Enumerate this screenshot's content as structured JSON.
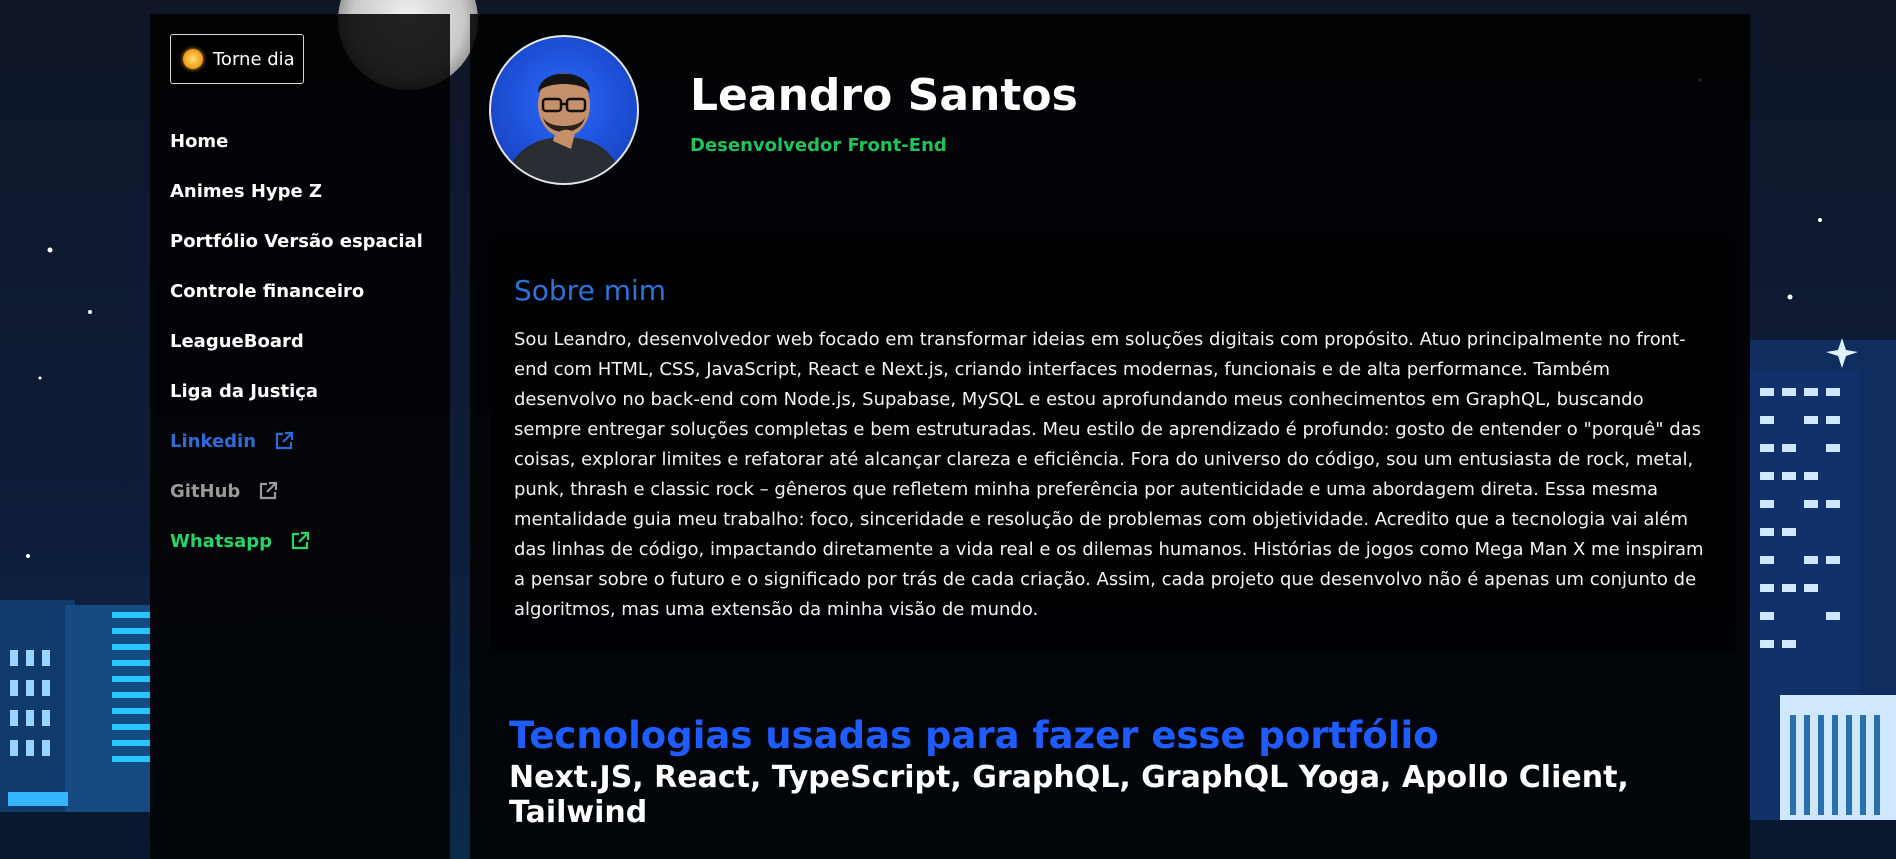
{
  "theme_toggle": {
    "icon": "sun-icon",
    "label": "Torne dia"
  },
  "sidebar": {
    "items": [
      {
        "label": "Home",
        "external": false
      },
      {
        "label": "Animes Hype Z",
        "external": false
      },
      {
        "label": "Portfólio Versão espacial",
        "external": false
      },
      {
        "label": "Controle financeiro",
        "external": false
      },
      {
        "label": "LeagueBoard",
        "external": false
      },
      {
        "label": "Liga da Justiça",
        "external": false
      },
      {
        "label": "Linkedin",
        "external": true,
        "color": "#2e6bd9"
      },
      {
        "label": "GitHub",
        "external": true,
        "color": "#9a9a9a"
      },
      {
        "label": "Whatsapp",
        "external": true,
        "color": "#25d366"
      }
    ]
  },
  "profile": {
    "name": "Leandro Santos",
    "role": "Desenvolvedor Front-End"
  },
  "about": {
    "heading": "Sobre mim",
    "text": "Sou Leandro, desenvolvedor web focado em transformar ideias em soluções digitais com propósito. Atuo principalmente no front-end com HTML, CSS, JavaScript, React e Next.js, criando interfaces modernas, funcionais e de alta performance. Também desenvolvo no back-end com Node.js, Supabase, MySQL e estou aprofundando meus conhecimentos em GraphQL, buscando sempre entregar soluções completas e bem estruturadas. Meu estilo de aprendizado é profundo: gosto de entender o \"porquê\" das coisas, explorar limites e refatorar até alcançar clareza e eficiência. Fora do universo do código, sou um entusiasta de rock, metal, punk, thrash e classic rock – gêneros que refletem minha preferência por autenticidade e uma abordagem direta. Essa mesma mentalidade guia meu trabalho: foco, sinceridade e resolução de problemas com objetividade. Acredito que a tecnologia vai além das linhas de código, impactando diretamente a vida real e os dilemas humanos. Histórias de jogos como Mega Man X me inspiram a pensar sobre o futuro e o significado por trás de cada criação. Assim, cada projeto que desenvolvo não é apenas um conjunto de algoritmos, mas uma extensão da minha visão de mundo."
  },
  "tech": {
    "title": "Tecnologias usadas para fazer esse portfólio",
    "list": "Next.JS, React, TypeScript, GraphQL, GraphQL Yoga, Apollo Client, Tailwind"
  },
  "colors": {
    "accent_blue": "#1e5cff",
    "role_green": "#21c25c",
    "heading_blue": "#2b73d8"
  }
}
